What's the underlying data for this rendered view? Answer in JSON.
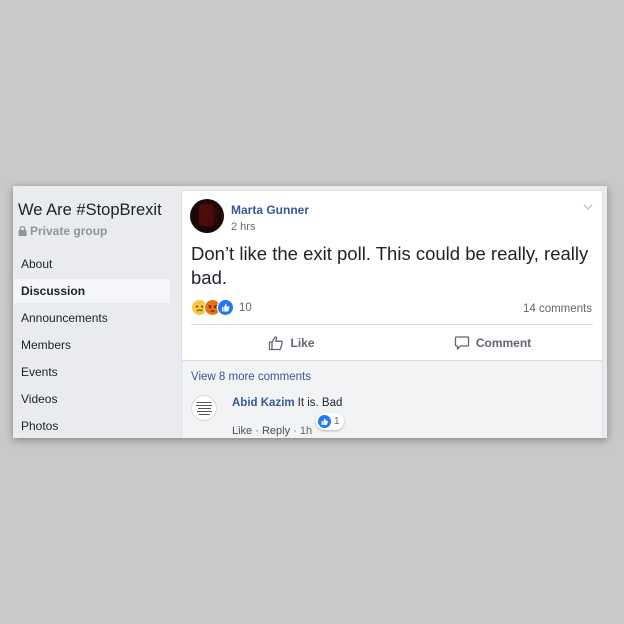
{
  "sidebar": {
    "group_name": "We Are #StopBrexit",
    "privacy_label": "Private group",
    "items": [
      {
        "label": "About",
        "active": false
      },
      {
        "label": "Discussion",
        "active": true
      },
      {
        "label": "Announcements",
        "active": false
      },
      {
        "label": "Members",
        "active": false
      },
      {
        "label": "Events",
        "active": false
      },
      {
        "label": "Videos",
        "active": false
      },
      {
        "label": "Photos",
        "active": false
      }
    ]
  },
  "post": {
    "author": "Marta Gunner",
    "time": "2 hrs",
    "text": "Don’t like the exit poll. This could be really, really bad.",
    "reaction_icons": [
      "sad-emoji-icon",
      "angry-emoji-icon",
      "like-icon"
    ],
    "reaction_count": "10",
    "comments_count": "14 comments",
    "like_label": "Like",
    "comment_label": "Comment"
  },
  "comments": {
    "view_more": "View 8 more comments",
    "items": [
      {
        "author": "Abid Kazim",
        "text": "It is. Bad",
        "like_link": "Like",
        "reply_link": "Reply",
        "separator": "·",
        "time": "1h",
        "reaction_count": "1"
      }
    ]
  },
  "colors": {
    "link_blue": "#365899",
    "page_bg": "#c9c9c9",
    "sidebar_bg": "#e9ebee",
    "like_blue": "#2078f4"
  }
}
